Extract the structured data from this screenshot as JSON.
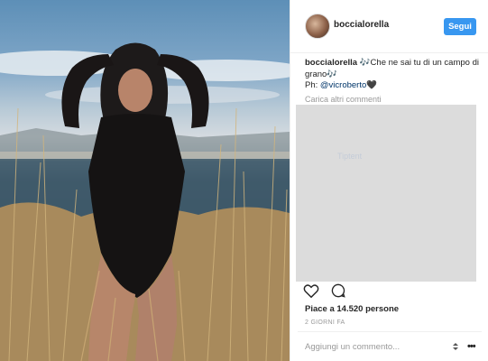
{
  "post": {
    "username": "boccialorella",
    "follow_label": "Segui",
    "caption_user": "boccialorella",
    "caption_text": " 🎶Che ne sai tu di un campo di grano🎶",
    "caption_credit_prefix": "Ph: ",
    "caption_mention": "@vicroberto",
    "caption_emoji": "🖤",
    "load_more_label": "Carica altri commenti",
    "overlay_text": "Tiptent",
    "likes_label": "Piace a 14.520 persone",
    "time_label": "2 GIORNI FA",
    "comment_placeholder": "Aggiungi un commento...",
    "more_label": "•••"
  },
  "icons": {
    "like": "heart-icon",
    "comment": "comment-icon",
    "scroll": "scroll-arrows-icon",
    "more": "more-options-icon"
  }
}
